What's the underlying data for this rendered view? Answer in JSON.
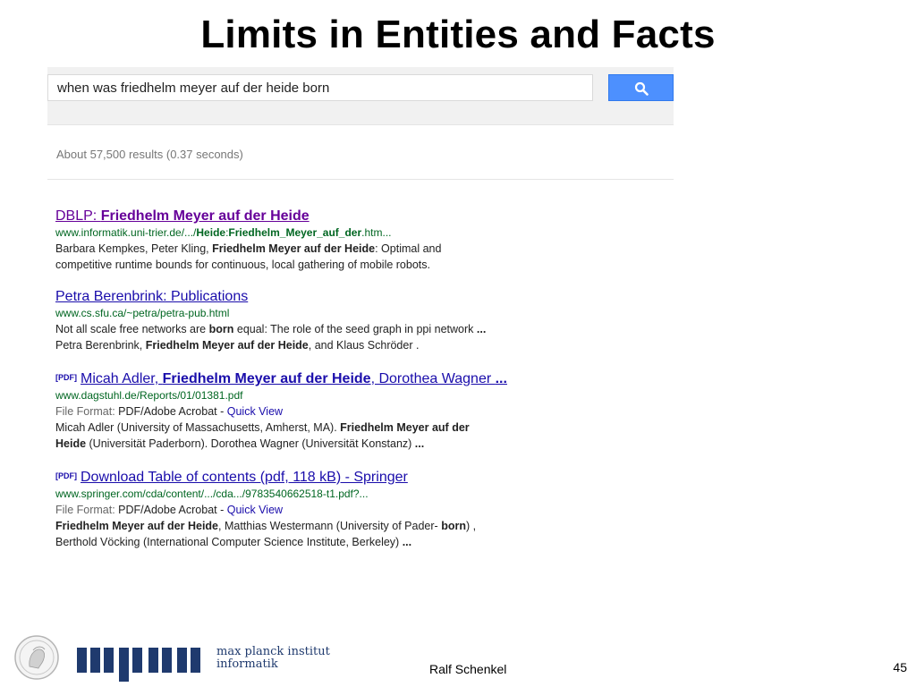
{
  "slide": {
    "title": "Limits in Entities and Facts",
    "author": "Ralf Schenkel",
    "page_number": "45",
    "logo_line1": "max planck institut",
    "logo_line2": "informatik"
  },
  "search": {
    "query": "when was friedhelm meyer auf der heide born",
    "button_icon": "search-icon",
    "stats": "About 57,500 results (0.37 seconds)"
  },
  "colors": {
    "link": "#1a0dab",
    "visited_link": "#660099",
    "url_green": "#006621",
    "button_blue": "#4d90fe"
  },
  "results": [
    {
      "title_prefix": "DBLP: ",
      "title_bold": "Friedhelm Meyer auf der Heide",
      "url_pre": "www.informatik.uni-trier.de/.../",
      "url_b1": "Heide",
      "url_sep": ":",
      "url_b2": "Friedhelm_Meyer_auf_der",
      "url_post": ".htm...",
      "l1_pre": "Barbara Kempkes, Peter Kling, ",
      "l1_bold": "Friedhelm Meyer auf der Heide",
      "l1_post": ": Optimal and",
      "l2": "competitive runtime bounds for continuous, local gathering of mobile robots."
    },
    {
      "title": "Petra Berenbrink: Publications",
      "url": "www.cs.sfu.ca/~petra/petra-pub.html",
      "l1_pre": "Not all scale free networks are ",
      "l1_bold": "born",
      "l1_post": " equal: The role of the seed graph in ppi network ",
      "l1_ell": "...",
      "l2_pre": "Petra Berenbrink, ",
      "l2_bold": "Friedhelm Meyer auf der Heide",
      "l2_post": ", and Klaus Schröder ."
    },
    {
      "tag": "[PDF]",
      "t_pre": "Micah Adler, ",
      "t_bold": "Friedhelm Meyer auf der Heide",
      "t_post": ", Dorothea Wagner ",
      "t_ell": "...",
      "url": "www.dagstuhl.de/Reports/01/01381.pdf",
      "ff_label": "File Format: ",
      "ff_value": "PDF/Adobe Acrobat - ",
      "quick_view": "Quick View",
      "l1_pre": "Micah Adler (University of Massachusetts, Amherst, MA). ",
      "l1_bold": "Friedhelm Meyer auf der",
      "l2_bold": "Heide",
      "l2_post": " (Universität Paderborn). Dorothea Wagner (Universität Konstanz) ",
      "l2_ell": "..."
    },
    {
      "tag": "[PDF]",
      "title": "Download Table of contents (pdf, 118 kB) - Springer",
      "url": "www.springer.com/cda/content/.../cda.../9783540662518-t1.pdf?...",
      "ff_label": "File Format: ",
      "ff_value": "PDF/Adobe Acrobat - ",
      "quick_view": "Quick View",
      "l1_bold": "Friedhelm Meyer auf der Heide",
      "l1_mid": ", Matthias Westermann (University of Pader- ",
      "l1_bold2": "born",
      "l1_post": ") ,",
      "l2_pre": "Berthold Vöcking (International Computer Science Institute, Berkeley) ",
      "l2_ell": "..."
    }
  ]
}
